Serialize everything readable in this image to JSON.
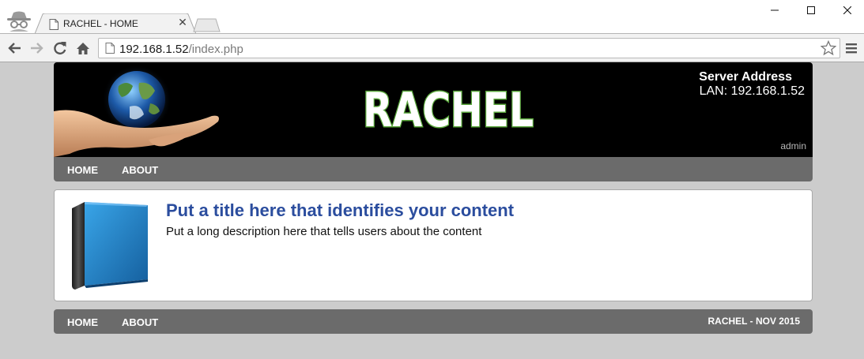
{
  "browser": {
    "tab": {
      "title": "RACHEL - HOME",
      "close": "✕"
    },
    "address": {
      "host": "192.168.1.52",
      "path": "/index.php"
    }
  },
  "banner": {
    "logo_text": "RACHEL",
    "server_title": "Server Address",
    "server_lan": "LAN: 192.168.1.52",
    "admin_label": "admin"
  },
  "nav": {
    "home": "HOME",
    "about": "ABOUT"
  },
  "content": {
    "title": "Put a title here that identifies your content",
    "description": "Put a long description here that tells users about the content"
  },
  "footer": {
    "home": "HOME",
    "about": "ABOUT",
    "credit": "RACHEL - NOV 2015"
  },
  "colors": {
    "nav_bar": "#6b6b6b",
    "title_link": "#2b4d9e",
    "logo_green": "#5aa83c",
    "page_bg": "#cccccc"
  },
  "icons": [
    "incognito-icon",
    "page-icon",
    "close-icon",
    "back-icon",
    "forward-icon",
    "reload-icon",
    "home-icon",
    "star-icon",
    "menu-icon",
    "book-icon"
  ]
}
